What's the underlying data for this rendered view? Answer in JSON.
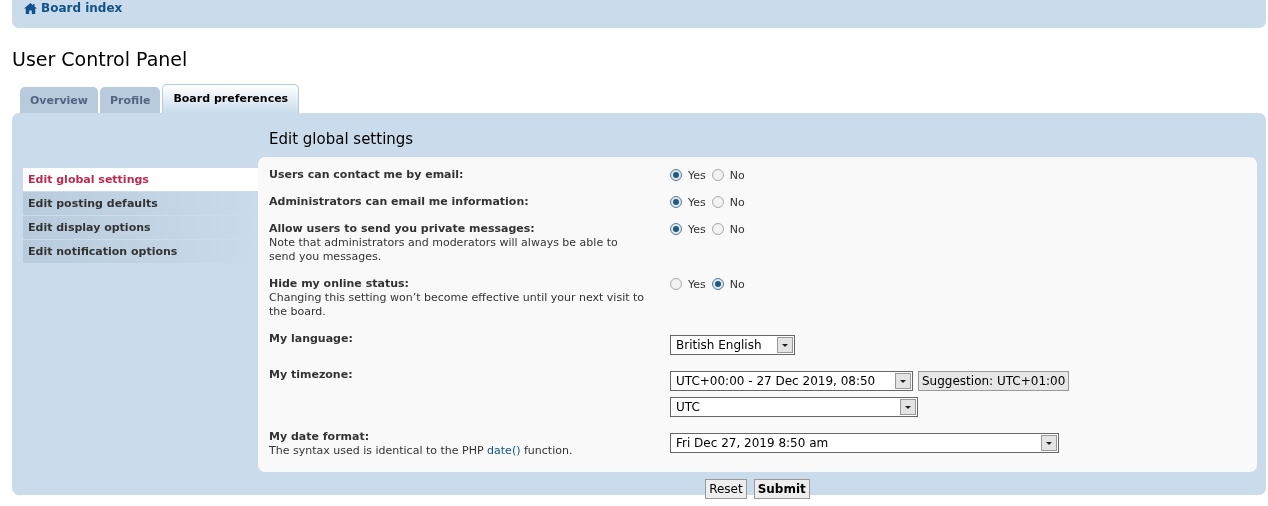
{
  "nav": {
    "home_link": "Board index"
  },
  "page_title": "User Control Panel",
  "tabs": [
    {
      "label": "Overview",
      "selected": false
    },
    {
      "label": "Profile",
      "selected": false
    },
    {
      "label": "Board preferences",
      "selected": true
    }
  ],
  "sidebar": {
    "items": [
      {
        "label": "Edit global settings",
        "selected": true
      },
      {
        "label": "Edit posting defaults",
        "selected": false
      },
      {
        "label": "Edit display options",
        "selected": false
      },
      {
        "label": "Edit notification options",
        "selected": false
      }
    ]
  },
  "section_title": "Edit global settings",
  "settings": [
    {
      "kind": "radio",
      "label": "Users can contact me by email:",
      "options": [
        {
          "label": "Yes",
          "selected": true
        },
        {
          "label": "No",
          "selected": false
        }
      ]
    },
    {
      "kind": "radio",
      "label": "Administrators can email me information:",
      "options": [
        {
          "label": "Yes",
          "selected": true
        },
        {
          "label": "No",
          "selected": false
        }
      ]
    },
    {
      "kind": "radio",
      "label": "Allow users to send you private messages:",
      "explain": "Note that administrators and moderators will always be able to send you messages.",
      "options": [
        {
          "label": "Yes",
          "selected": true
        },
        {
          "label": "No",
          "selected": false
        }
      ]
    },
    {
      "kind": "radio",
      "label": "Hide my online status:",
      "explain": "Changing this setting won’t become effective until your next visit to the board.",
      "options": [
        {
          "label": "Yes",
          "selected": false
        },
        {
          "label": "No",
          "selected": true
        }
      ]
    },
    {
      "kind": "select",
      "label": "My language:",
      "selects": [
        {
          "value": "British English"
        }
      ]
    },
    {
      "kind": "select",
      "label": "My timezone:",
      "selects": [
        {
          "value": "UTC+00:00 - 27 Dec 2019, 08:50",
          "suggestion": "Suggestion: UTC+01:00"
        },
        {
          "value": "UTC"
        }
      ]
    },
    {
      "kind": "select",
      "label": "My date format:",
      "explain": "The syntax used is identical to the PHP ",
      "explain_link": "date()",
      "explain_after": " function.",
      "selects": [
        {
          "value": "Fri Dec 27, 2019 8:50 am"
        }
      ]
    }
  ],
  "buttons": [
    {
      "label": "Reset",
      "primary": false
    },
    {
      "label": "Submit",
      "primary": true
    }
  ]
}
